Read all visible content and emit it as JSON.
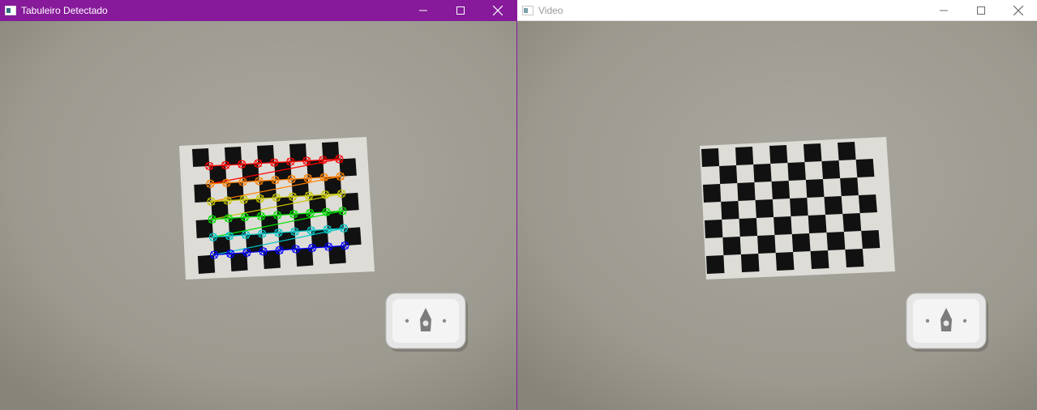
{
  "windows": {
    "left": {
      "title": "Tabuleiro Detectado",
      "active": true,
      "titlebar_color": "#861a9a",
      "icon": "opencv-window-icon",
      "controls": [
        "minimize-icon",
        "maximize-icon",
        "close-icon"
      ]
    },
    "right": {
      "title": "Video",
      "active": false,
      "titlebar_color": "#ffffff",
      "icon": "opencv-window-icon",
      "controls": [
        "minimize-icon",
        "maximize-icon",
        "close-icon"
      ]
    }
  },
  "scene": {
    "board_squares": "10 x 7",
    "inner_corners": "9 x 6",
    "corner_row_colors": [
      "#ff0000",
      "#ff8000",
      "#c8c800",
      "#00e000",
      "#00c8c8",
      "#0000ff"
    ],
    "wall_color": "#a3a199",
    "outlet": "wall-light-switch"
  }
}
